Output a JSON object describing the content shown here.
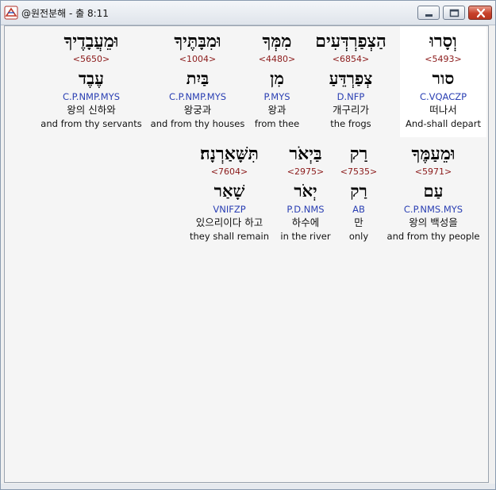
{
  "window": {
    "title": "@원전분해 - 출 8:11"
  },
  "rows": [
    {
      "words": [
        {
          "hebrew": "וְסָרוּ",
          "strong": "<5493>",
          "lemma": "סור",
          "morph": "C.VQACZP",
          "korean": "떠나서",
          "english": "And-shall depart",
          "selected": true
        },
        {
          "hebrew": "הַצְפַרְדְּעִים",
          "strong": "<6854>",
          "lemma": "צְפַרְדֵּעַ",
          "morph": "D.NFP",
          "korean": "개구리가",
          "english": "the frogs"
        },
        {
          "hebrew": "מִמְּךָ",
          "strong": "<4480>",
          "lemma": "מִן",
          "morph": "P.MYS",
          "korean": "왕과",
          "english": "from thee"
        },
        {
          "hebrew": "וּמִבָּתֶּיךָ",
          "strong": "<1004>",
          "lemma": "בַּיִת",
          "morph": "C.P.NMP.MYS",
          "korean": "왕궁과",
          "english": "and from thy houses"
        },
        {
          "hebrew": "וּמֵעֲבָדֶיךָ",
          "strong": "<5650>",
          "lemma": "עֶבֶד",
          "morph": "C.P.NMP.MYS",
          "korean": "왕의 신하와",
          "english": "and from thy servants"
        }
      ]
    },
    {
      "words": [
        {
          "hebrew": "וּמֵעַמֶּךָ",
          "strong": "<5971>",
          "lemma": "עַם",
          "morph": "C.P.NMS.MYS",
          "korean": "왕의 백성을",
          "english": "and from thy people"
        },
        {
          "hebrew": "רַק",
          "strong": "<7535>",
          "lemma": "רַק",
          "morph": "AB",
          "korean": "만",
          "english": "only"
        },
        {
          "hebrew": "בַּיְאֹר",
          "strong": "<2975>",
          "lemma": "יְאֹר",
          "morph": "P.D.NMS",
          "korean": "하수에",
          "english": "in the river"
        },
        {
          "hebrew": "תִּשָּׁאַרְנָה׃",
          "strong": "<7604>",
          "lemma": "שָׁאַר",
          "morph": "VNIFZP",
          "korean": "있으리이다 하고",
          "english": "they shall remain"
        }
      ]
    }
  ]
}
